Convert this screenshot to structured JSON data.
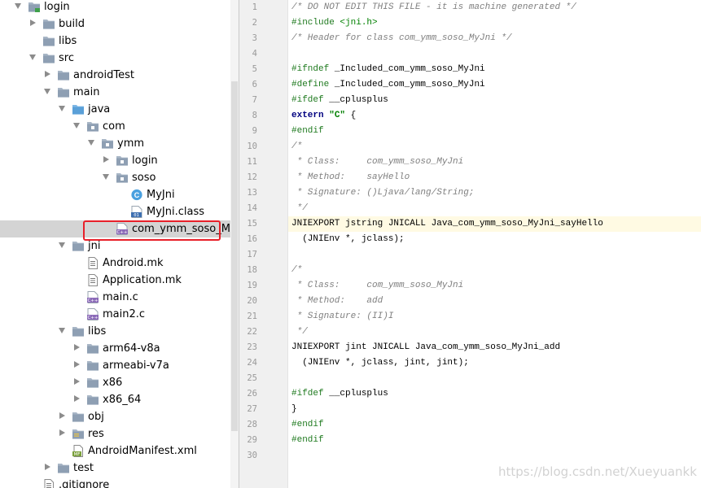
{
  "project_tree": {
    "selected_item": "com_ymm_soso_MyJni.h",
    "items": [
      {
        "label": "login",
        "icon": "module-folder-icon",
        "expanded": true
      },
      {
        "label": "build",
        "icon": "folder-icon",
        "expanded": false
      },
      {
        "label": "libs",
        "icon": "folder-icon",
        "expanded": null
      },
      {
        "label": "src",
        "icon": "folder-icon",
        "expanded": true
      },
      {
        "label": "androidTest",
        "icon": "folder-icon",
        "expanded": false
      },
      {
        "label": "main",
        "icon": "folder-icon",
        "expanded": true
      },
      {
        "label": "java",
        "icon": "source-folder-icon",
        "expanded": true
      },
      {
        "label": "com",
        "icon": "package-icon",
        "expanded": true
      },
      {
        "label": "ymm",
        "icon": "package-icon",
        "expanded": true
      },
      {
        "label": "login",
        "icon": "package-icon",
        "expanded": false
      },
      {
        "label": "soso",
        "icon": "package-icon",
        "expanded": true
      },
      {
        "label": "MyJni",
        "icon": "java-class-icon",
        "expanded": null
      },
      {
        "label": "MyJni.class",
        "icon": "class-file-icon",
        "expanded": null
      },
      {
        "label": "com_ymm_soso_MyJni.h",
        "icon": "cpp-header-icon",
        "expanded": null
      },
      {
        "label": "jni",
        "icon": "folder-icon",
        "expanded": true
      },
      {
        "label": "Android.mk",
        "icon": "text-file-icon",
        "expanded": null
      },
      {
        "label": "Application.mk",
        "icon": "text-file-icon",
        "expanded": null
      },
      {
        "label": "main.c",
        "icon": "cpp-file-icon",
        "expanded": null
      },
      {
        "label": "main2.c",
        "icon": "cpp-file-icon",
        "expanded": null
      },
      {
        "label": "libs",
        "icon": "folder-icon",
        "expanded": true
      },
      {
        "label": "arm64-v8a",
        "icon": "folder-icon",
        "expanded": false
      },
      {
        "label": "armeabi-v7a",
        "icon": "folder-icon",
        "expanded": false
      },
      {
        "label": "x86",
        "icon": "folder-icon",
        "expanded": false
      },
      {
        "label": "x86_64",
        "icon": "folder-icon",
        "expanded": false
      },
      {
        "label": "obj",
        "icon": "folder-icon",
        "expanded": false
      },
      {
        "label": "res",
        "icon": "resource-folder-icon",
        "expanded": false
      },
      {
        "label": "AndroidManifest.xml",
        "icon": "manifest-file-icon",
        "expanded": null
      },
      {
        "label": "test",
        "icon": "folder-icon",
        "expanded": false
      },
      {
        "label": ".gitignore",
        "icon": "text-file-icon",
        "expanded": null
      }
    ]
  },
  "editor": {
    "current_line": 15,
    "lines": [
      {
        "n": "1",
        "segs": [
          {
            "t": "/* DO NOT EDIT THIS FILE - it is machine generated */",
            "c": "comment"
          }
        ]
      },
      {
        "n": "2",
        "segs": [
          {
            "t": "#include ",
            "c": "pp"
          },
          {
            "t": "<jni.h>",
            "c": "inc"
          }
        ]
      },
      {
        "n": "3",
        "segs": [
          {
            "t": "/* Header for class com_ymm_soso_MyJni */",
            "c": "comment"
          }
        ]
      },
      {
        "n": "4",
        "segs": []
      },
      {
        "n": "5",
        "segs": [
          {
            "t": "#ifndef ",
            "c": "pp"
          },
          {
            "t": "_Included_com_ymm_soso_MyJni",
            "c": ""
          }
        ]
      },
      {
        "n": "6",
        "segs": [
          {
            "t": "#define ",
            "c": "pp"
          },
          {
            "t": "_Included_com_ymm_soso_MyJni",
            "c": ""
          }
        ]
      },
      {
        "n": "7",
        "segs": [
          {
            "t": "#ifdef ",
            "c": "pp"
          },
          {
            "t": "__cplusplus",
            "c": ""
          }
        ]
      },
      {
        "n": "8",
        "segs": [
          {
            "t": "extern ",
            "c": "kw"
          },
          {
            "t": "\"C\"",
            "c": "str"
          },
          {
            "t": " {",
            "c": ""
          }
        ]
      },
      {
        "n": "9",
        "segs": [
          {
            "t": "#endif",
            "c": "pp"
          }
        ]
      },
      {
        "n": "10",
        "segs": [
          {
            "t": "/*",
            "c": "comment"
          }
        ]
      },
      {
        "n": "11",
        "segs": [
          {
            "t": " * Class:     com_ymm_soso_MyJni",
            "c": "comment"
          }
        ]
      },
      {
        "n": "12",
        "segs": [
          {
            "t": " * Method:    sayHello",
            "c": "comment"
          }
        ]
      },
      {
        "n": "13",
        "segs": [
          {
            "t": " * Signature: ()Ljava/lang/String;",
            "c": "comment"
          }
        ]
      },
      {
        "n": "14",
        "segs": [
          {
            "t": " */",
            "c": "comment"
          }
        ]
      },
      {
        "n": "15",
        "segs": [
          {
            "t": "JNIEXPORT jstring JNICALL Java_com_ymm_soso_MyJni_sayHello",
            "c": ""
          }
        ]
      },
      {
        "n": "16",
        "segs": [
          {
            "t": "  (JNIEnv *, jclass);",
            "c": ""
          }
        ]
      },
      {
        "n": "17",
        "segs": []
      },
      {
        "n": "18",
        "segs": [
          {
            "t": "/*",
            "c": "comment"
          }
        ]
      },
      {
        "n": "19",
        "segs": [
          {
            "t": " * Class:     com_ymm_soso_MyJni",
            "c": "comment"
          }
        ]
      },
      {
        "n": "20",
        "segs": [
          {
            "t": " * Method:    add",
            "c": "comment"
          }
        ]
      },
      {
        "n": "21",
        "segs": [
          {
            "t": " * Signature: (II)I",
            "c": "comment"
          }
        ]
      },
      {
        "n": "22",
        "segs": [
          {
            "t": " */",
            "c": "comment"
          }
        ]
      },
      {
        "n": "23",
        "segs": [
          {
            "t": "JNIEXPORT jint JNICALL Java_com_ymm_soso_MyJni_add",
            "c": ""
          }
        ]
      },
      {
        "n": "24",
        "segs": [
          {
            "t": "  (JNIEnv *, jclass, jint, jint);",
            "c": ""
          }
        ]
      },
      {
        "n": "25",
        "segs": []
      },
      {
        "n": "26",
        "segs": [
          {
            "t": "#ifdef ",
            "c": "pp"
          },
          {
            "t": "__cplusplus",
            "c": ""
          }
        ]
      },
      {
        "n": "27",
        "segs": [
          {
            "t": "}",
            "c": ""
          }
        ]
      },
      {
        "n": "28",
        "segs": [
          {
            "t": "#endif",
            "c": "pp"
          }
        ]
      },
      {
        "n": "29",
        "segs": [
          {
            "t": "#endif",
            "c": "pp"
          }
        ]
      },
      {
        "n": "30",
        "segs": []
      }
    ]
  },
  "watermark": "https://blog.csdn.net/Xueyuankk",
  "colors": {
    "selection": "#d4d4d4",
    "highlight_box": "#e8202a",
    "gutter": "#f0f0f0",
    "current_line": "#fffae3",
    "folder": "#a8b6c6",
    "source_folder": "#5aa0d8"
  }
}
